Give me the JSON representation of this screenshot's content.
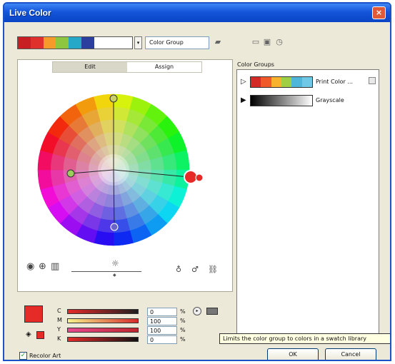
{
  "window": {
    "title": "Live Color",
    "close_glyph": "×"
  },
  "toolbar": {
    "active_group_colors": [
      "#c81f24",
      "#e0302c",
      "#f59a2b",
      "#8ec640",
      "#26a9c9",
      "#2c3e9e",
      "#ffffff"
    ],
    "group_name_value": "Color Group",
    "icons": [
      "save-group-icon",
      "new-group-icon",
      "edit-group-icon",
      "delete-group-icon"
    ]
  },
  "edit_panel": {
    "tabs": [
      {
        "label": "Edit",
        "active": true
      },
      {
        "label": "Assign",
        "active": false
      }
    ],
    "wheel_tools": [
      "smooth-wheel-icon",
      "segmented-wheel-icon",
      "color-bars-icon"
    ],
    "brightness_icon": "sun-icon",
    "harmony_tools": [
      "add-color-icon",
      "remove-color-icon",
      "link-harmony-icon"
    ]
  },
  "color_groups": {
    "label": "Color Groups",
    "items": [
      {
        "name": "Print Color ...",
        "colors": [
          "#d42a25",
          "#f05a2b",
          "#f8b22e",
          "#9fcf44",
          "#4fb6d9",
          "#6ec8e6"
        ]
      },
      {
        "name": "Grayscale",
        "colors": [
          "#000000",
          "#333333",
          "#666666",
          "#999999",
          "#cccccc",
          "#ffffff"
        ]
      }
    ]
  },
  "cmyk": {
    "fill_color": "#e52a28",
    "rows": [
      {
        "label": "C",
        "value": "0",
        "unit": "%",
        "bar_gradient": [
          "#e52a28",
          "#1e1e1e"
        ]
      },
      {
        "label": "M",
        "value": "100",
        "unit": "%",
        "bar_gradient": [
          "#f7f48c",
          "#d62a2a"
        ]
      },
      {
        "label": "Y",
        "value": "100",
        "unit": "%",
        "bar_gradient": [
          "#e84a8e",
          "#c0272d"
        ]
      },
      {
        "label": "K",
        "value": "0",
        "unit": "%",
        "bar_gradient": [
          "#e52a28",
          "#111111"
        ]
      }
    ],
    "tooltip": "Limits the color group to colors in a swatch library"
  },
  "footer": {
    "recolor_art_label": "Recolor Art",
    "recolor_art_checked": true,
    "ok_label": "OK",
    "cancel_label": "Cancel"
  }
}
